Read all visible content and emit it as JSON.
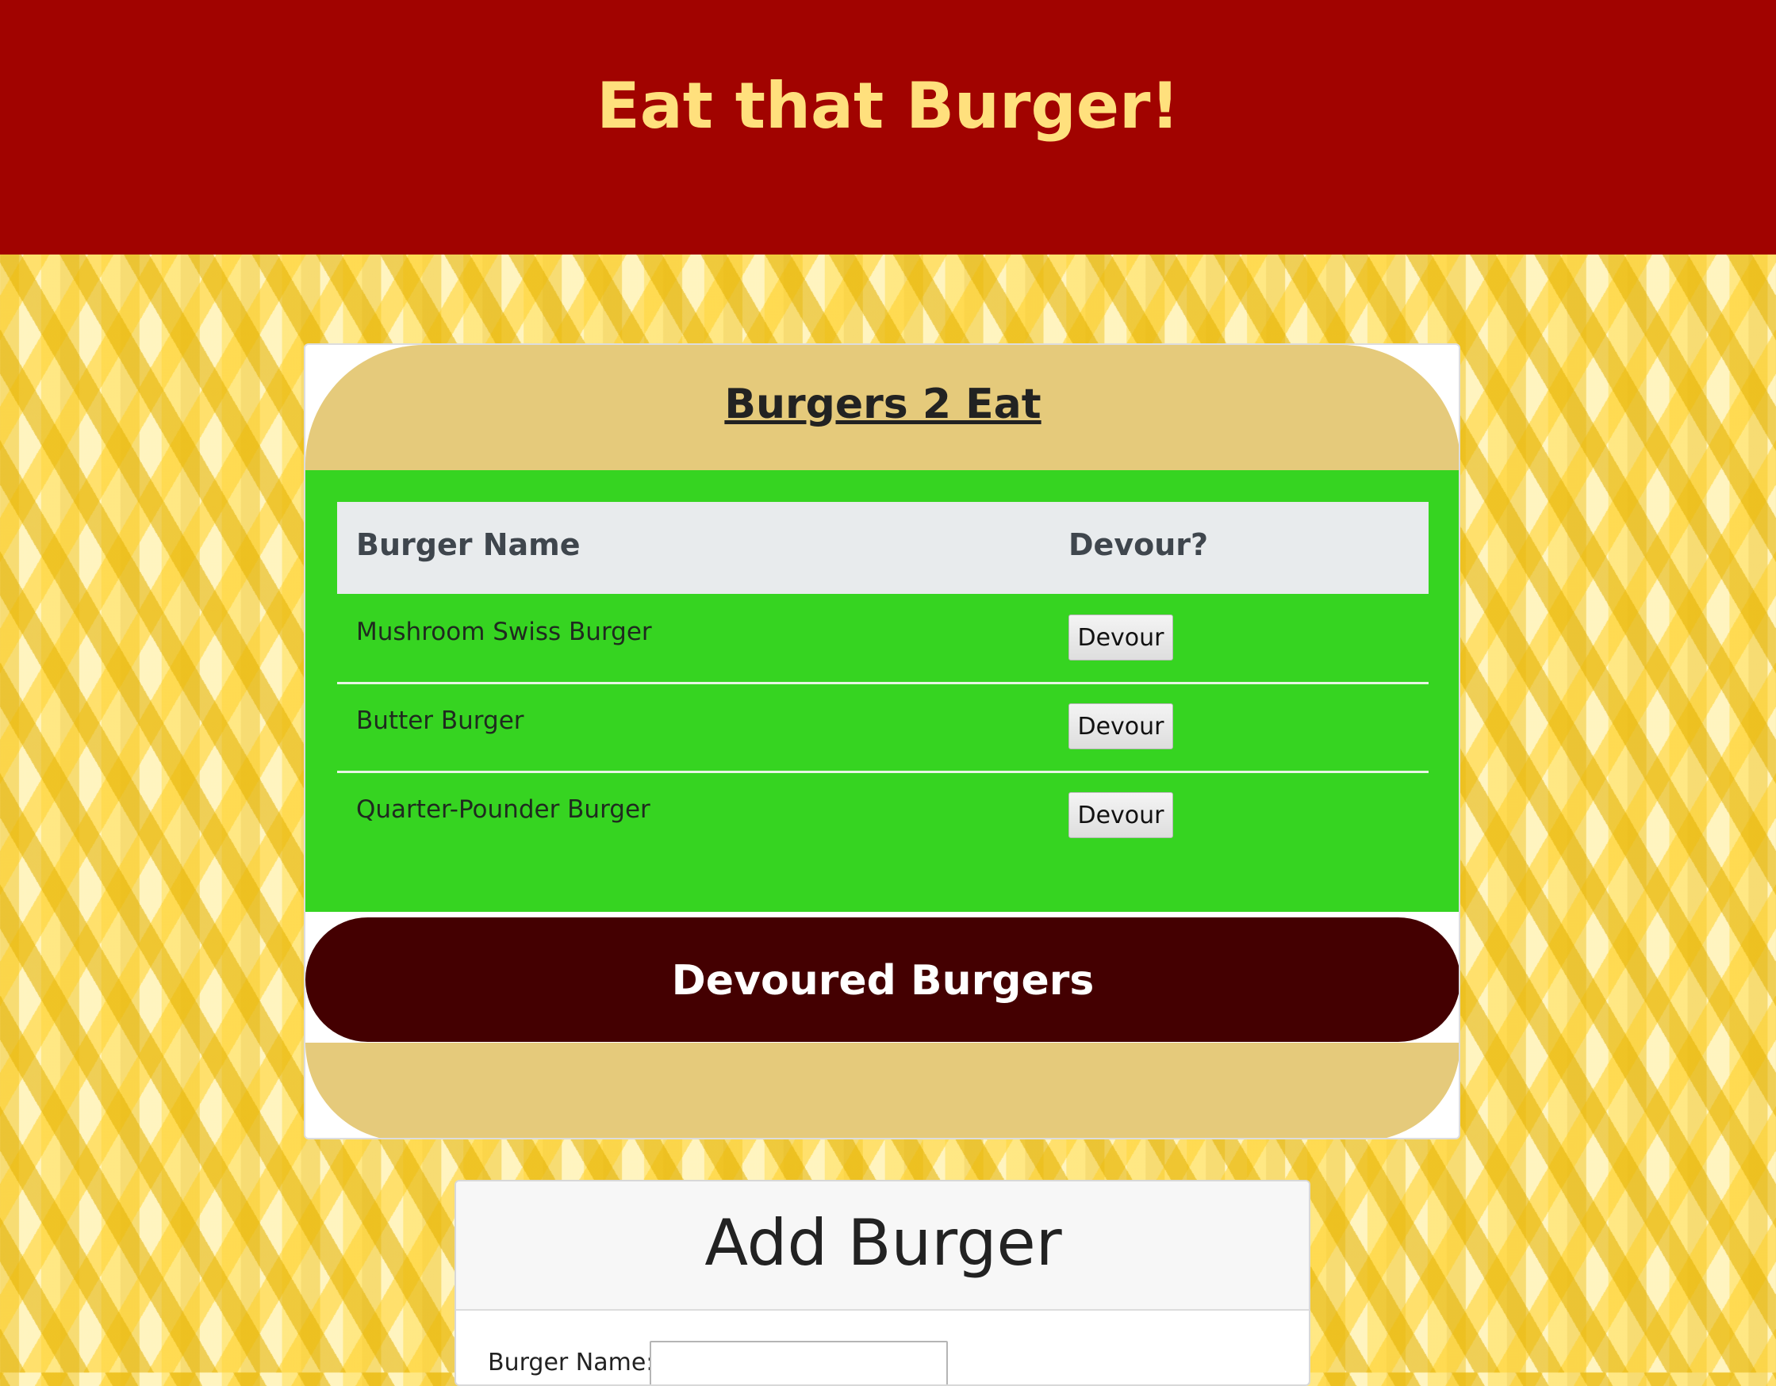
{
  "header": {
    "title": "Eat that Burger!"
  },
  "burgers_card": {
    "title": "Burgers 2 Eat",
    "columns": [
      "Burger Name",
      "Devour?"
    ],
    "rows": [
      {
        "name": "Mushroom Swiss Burger",
        "action": "Devour"
      },
      {
        "name": "Butter Burger",
        "action": "Devour"
      },
      {
        "name": "Quarter-Pounder Burger",
        "action": "Devour"
      }
    ],
    "devoured_title": "Devoured Burgers"
  },
  "add_form": {
    "title": "Add Burger",
    "label": "Burger Name:",
    "input_value": ""
  },
  "colors": {
    "header_bg": "#a10300",
    "header_text": "#ffe07d",
    "bun": "#e5ca7b",
    "patty": "#36d421",
    "devoured_bg": "#440001"
  }
}
